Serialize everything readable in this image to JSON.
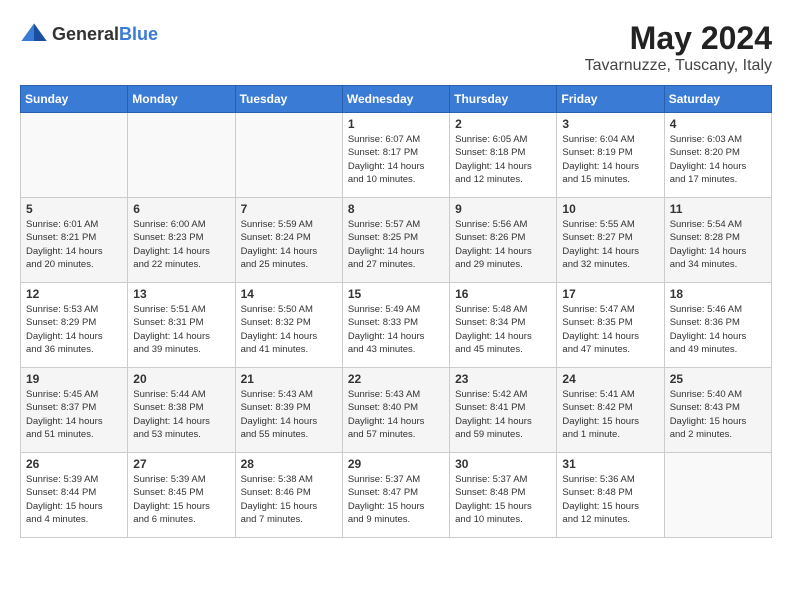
{
  "header": {
    "logo_general": "General",
    "logo_blue": "Blue",
    "title": "May 2024",
    "location": "Tavarnuzze, Tuscany, Italy"
  },
  "weekdays": [
    "Sunday",
    "Monday",
    "Tuesday",
    "Wednesday",
    "Thursday",
    "Friday",
    "Saturday"
  ],
  "weeks": [
    [
      {
        "day": "",
        "info": ""
      },
      {
        "day": "",
        "info": ""
      },
      {
        "day": "",
        "info": ""
      },
      {
        "day": "1",
        "info": "Sunrise: 6:07 AM\nSunset: 8:17 PM\nDaylight: 14 hours\nand 10 minutes."
      },
      {
        "day": "2",
        "info": "Sunrise: 6:05 AM\nSunset: 8:18 PM\nDaylight: 14 hours\nand 12 minutes."
      },
      {
        "day": "3",
        "info": "Sunrise: 6:04 AM\nSunset: 8:19 PM\nDaylight: 14 hours\nand 15 minutes."
      },
      {
        "day": "4",
        "info": "Sunrise: 6:03 AM\nSunset: 8:20 PM\nDaylight: 14 hours\nand 17 minutes."
      }
    ],
    [
      {
        "day": "5",
        "info": "Sunrise: 6:01 AM\nSunset: 8:21 PM\nDaylight: 14 hours\nand 20 minutes."
      },
      {
        "day": "6",
        "info": "Sunrise: 6:00 AM\nSunset: 8:23 PM\nDaylight: 14 hours\nand 22 minutes."
      },
      {
        "day": "7",
        "info": "Sunrise: 5:59 AM\nSunset: 8:24 PM\nDaylight: 14 hours\nand 25 minutes."
      },
      {
        "day": "8",
        "info": "Sunrise: 5:57 AM\nSunset: 8:25 PM\nDaylight: 14 hours\nand 27 minutes."
      },
      {
        "day": "9",
        "info": "Sunrise: 5:56 AM\nSunset: 8:26 PM\nDaylight: 14 hours\nand 29 minutes."
      },
      {
        "day": "10",
        "info": "Sunrise: 5:55 AM\nSunset: 8:27 PM\nDaylight: 14 hours\nand 32 minutes."
      },
      {
        "day": "11",
        "info": "Sunrise: 5:54 AM\nSunset: 8:28 PM\nDaylight: 14 hours\nand 34 minutes."
      }
    ],
    [
      {
        "day": "12",
        "info": "Sunrise: 5:53 AM\nSunset: 8:29 PM\nDaylight: 14 hours\nand 36 minutes."
      },
      {
        "day": "13",
        "info": "Sunrise: 5:51 AM\nSunset: 8:31 PM\nDaylight: 14 hours\nand 39 minutes."
      },
      {
        "day": "14",
        "info": "Sunrise: 5:50 AM\nSunset: 8:32 PM\nDaylight: 14 hours\nand 41 minutes."
      },
      {
        "day": "15",
        "info": "Sunrise: 5:49 AM\nSunset: 8:33 PM\nDaylight: 14 hours\nand 43 minutes."
      },
      {
        "day": "16",
        "info": "Sunrise: 5:48 AM\nSunset: 8:34 PM\nDaylight: 14 hours\nand 45 minutes."
      },
      {
        "day": "17",
        "info": "Sunrise: 5:47 AM\nSunset: 8:35 PM\nDaylight: 14 hours\nand 47 minutes."
      },
      {
        "day": "18",
        "info": "Sunrise: 5:46 AM\nSunset: 8:36 PM\nDaylight: 14 hours\nand 49 minutes."
      }
    ],
    [
      {
        "day": "19",
        "info": "Sunrise: 5:45 AM\nSunset: 8:37 PM\nDaylight: 14 hours\nand 51 minutes."
      },
      {
        "day": "20",
        "info": "Sunrise: 5:44 AM\nSunset: 8:38 PM\nDaylight: 14 hours\nand 53 minutes."
      },
      {
        "day": "21",
        "info": "Sunrise: 5:43 AM\nSunset: 8:39 PM\nDaylight: 14 hours\nand 55 minutes."
      },
      {
        "day": "22",
        "info": "Sunrise: 5:43 AM\nSunset: 8:40 PM\nDaylight: 14 hours\nand 57 minutes."
      },
      {
        "day": "23",
        "info": "Sunrise: 5:42 AM\nSunset: 8:41 PM\nDaylight: 14 hours\nand 59 minutes."
      },
      {
        "day": "24",
        "info": "Sunrise: 5:41 AM\nSunset: 8:42 PM\nDaylight: 15 hours\nand 1 minute."
      },
      {
        "day": "25",
        "info": "Sunrise: 5:40 AM\nSunset: 8:43 PM\nDaylight: 15 hours\nand 2 minutes."
      }
    ],
    [
      {
        "day": "26",
        "info": "Sunrise: 5:39 AM\nSunset: 8:44 PM\nDaylight: 15 hours\nand 4 minutes."
      },
      {
        "day": "27",
        "info": "Sunrise: 5:39 AM\nSunset: 8:45 PM\nDaylight: 15 hours\nand 6 minutes."
      },
      {
        "day": "28",
        "info": "Sunrise: 5:38 AM\nSunset: 8:46 PM\nDaylight: 15 hours\nand 7 minutes."
      },
      {
        "day": "29",
        "info": "Sunrise: 5:37 AM\nSunset: 8:47 PM\nDaylight: 15 hours\nand 9 minutes."
      },
      {
        "day": "30",
        "info": "Sunrise: 5:37 AM\nSunset: 8:48 PM\nDaylight: 15 hours\nand 10 minutes."
      },
      {
        "day": "31",
        "info": "Sunrise: 5:36 AM\nSunset: 8:48 PM\nDaylight: 15 hours\nand 12 minutes."
      },
      {
        "day": "",
        "info": ""
      }
    ]
  ]
}
